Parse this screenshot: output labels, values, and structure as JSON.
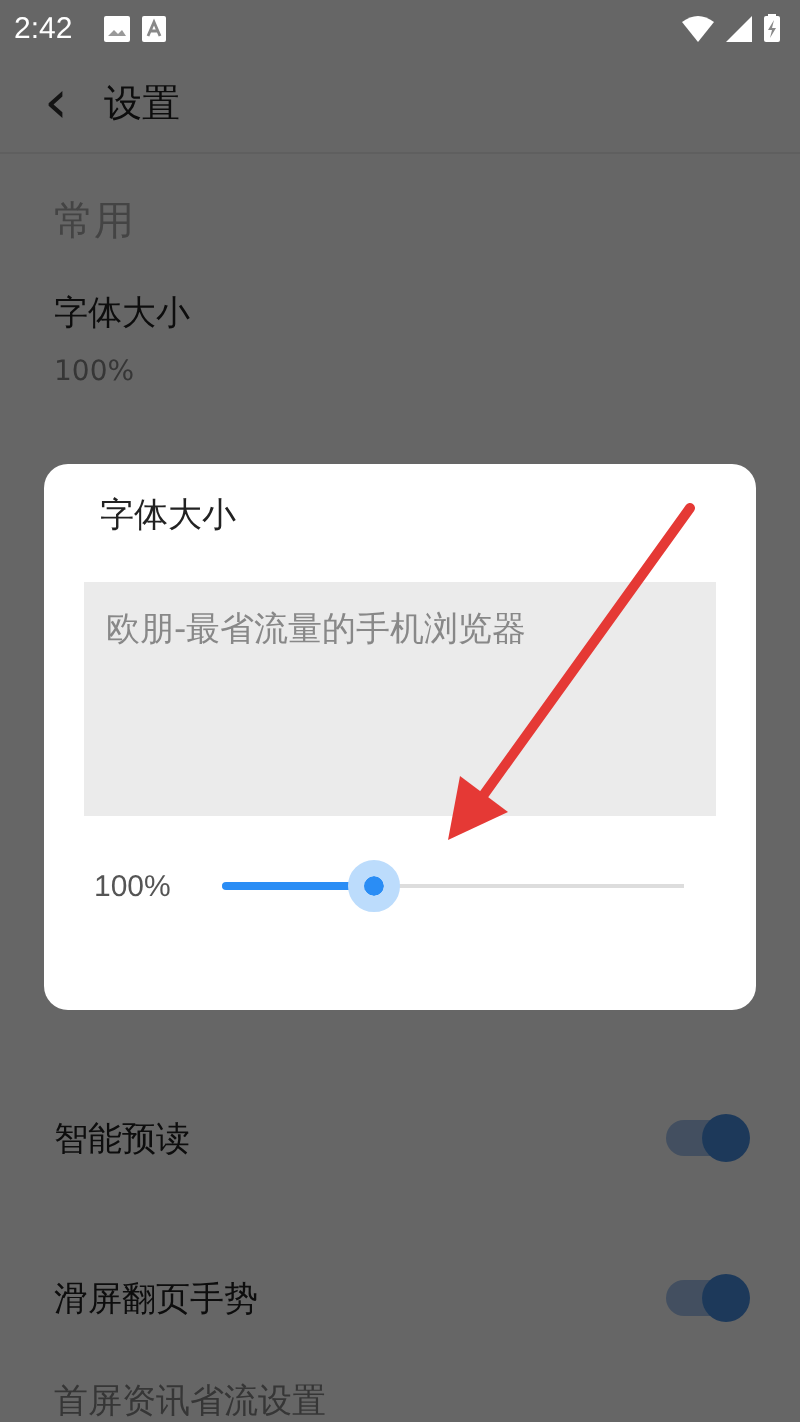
{
  "status_bar": {
    "time": "2:42"
  },
  "toolbar": {
    "back": "‹",
    "title": "设置"
  },
  "section": {
    "title": "常用"
  },
  "settings": [
    {
      "kind": "value",
      "title": "字体大小",
      "value": "100%"
    },
    {
      "kind": "toggle",
      "title": "智能预读",
      "on": true
    },
    {
      "kind": "toggle",
      "title": "滑屏翻页手势",
      "on": true
    },
    {
      "kind": "cut",
      "title": "首屏资讯省流设置"
    }
  ],
  "dialog": {
    "title": "字体大小",
    "preview": "欧朋-最省流量的手机浏览器",
    "reading": "100%",
    "level": 0.33
  }
}
